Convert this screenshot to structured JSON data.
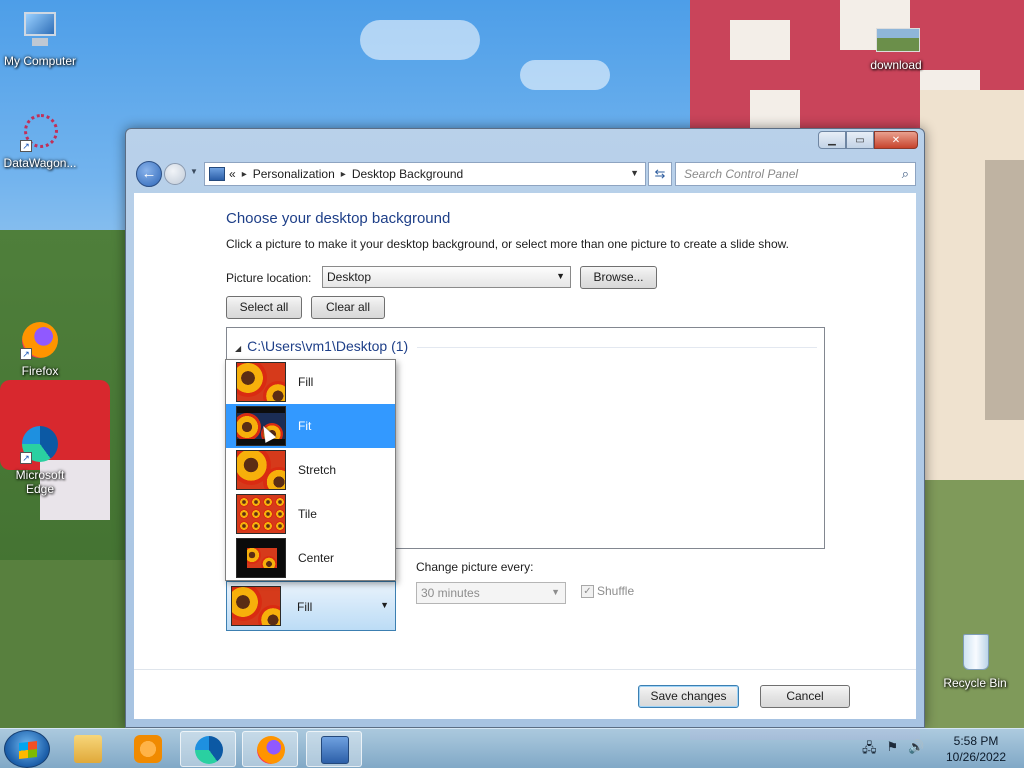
{
  "desktop": {
    "icons": [
      {
        "label": "My Computer"
      },
      {
        "label": "DataWagon..."
      },
      {
        "label": "Firefox"
      },
      {
        "label": "Microsoft Edge"
      },
      {
        "label": "download"
      },
      {
        "label": "Recycle Bin"
      }
    ]
  },
  "window": {
    "caption_buttons": {
      "minimize": "▁",
      "maximize": "▭",
      "close": "✕"
    },
    "address": {
      "overflow": "«",
      "crumbs": [
        "Personalization",
        "Desktop Background"
      ],
      "separator": "▸"
    },
    "search_placeholder": "Search Control Panel",
    "heading": "Choose your desktop background",
    "description": "Click a picture to make it your desktop background, or select more than one picture to create a slide show.",
    "picture_location_label": "Picture location:",
    "picture_location_value": "Desktop",
    "browse_label": "Browse...",
    "select_all_label": "Select all",
    "clear_all_label": "Clear all",
    "group_header": "C:\\Users\\vm1\\Desktop (1)",
    "change_picture_label": "Change picture every:",
    "change_picture_value": "30 minutes",
    "shuffle_label": "Shuffle",
    "shuffle_checked": true,
    "position_value": "Fill",
    "save_label": "Save changes",
    "cancel_label": "Cancel"
  },
  "position_dropdown": {
    "options": [
      "Fill",
      "Fit",
      "Stretch",
      "Tile",
      "Center"
    ],
    "highlighted": "Fit"
  },
  "taskbar": {
    "time": "5:58 PM",
    "date": "10/26/2022"
  },
  "colors": {
    "highlight": "#3399ff",
    "heading": "#1e3f88",
    "wallpaper_building": "#c9445a"
  }
}
